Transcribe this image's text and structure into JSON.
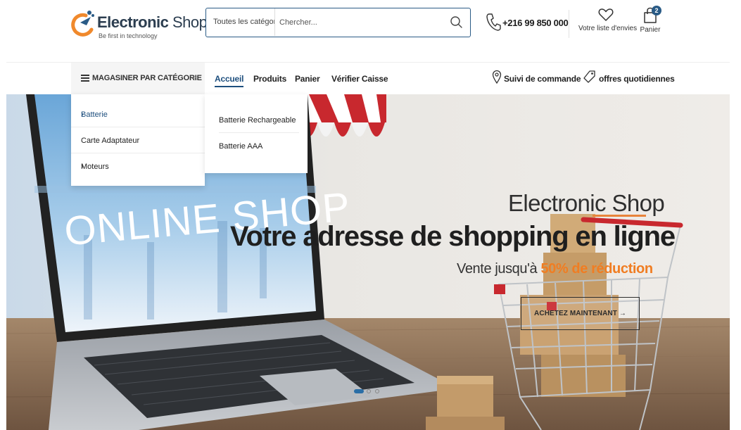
{
  "header": {
    "logo": {
      "brand_bold": "Electronic",
      "brand_light": "Shop",
      "tagline": "Be first in technology"
    },
    "search": {
      "category_label": "Toutes les catégor",
      "placeholder": "Chercher..."
    },
    "phone": "+216 99 850 000",
    "wishlist_label": "Votre liste d'envies",
    "cart": {
      "label": "Panier",
      "count": "2"
    }
  },
  "nav": {
    "category_toggle": "MAGASINER PAR CATÉGORIE",
    "links": [
      "Accueil",
      "Produits",
      "Panier",
      "Vérifier Caisse"
    ],
    "active_link": "Accueil",
    "order_tracking": "Suivi de commande",
    "daily_deals": "offres quotidiennes"
  },
  "category_menu": {
    "items": [
      {
        "label": "Batterie",
        "has_submenu": true,
        "active": true
      },
      {
        "label": "Carte Adaptateur",
        "has_submenu": false,
        "active": false
      },
      {
        "label": "Moteurs",
        "has_submenu": true,
        "active": false
      }
    ],
    "submenu": [
      "Batterie Rechargeable",
      "Batterie AAA"
    ]
  },
  "hero": {
    "brand": "Electronic Shop",
    "title": "Votre adresse de shopping en ligne",
    "subtitle_prefix": "Vente jusqu'à ",
    "subtitle_highlight": "50% de réduction",
    "cta": "ACHETEZ MAINTENANT →",
    "laptop_screen_text": "ONLINE SHOP",
    "slides_total": 3,
    "slide_active": 1
  },
  "colors": {
    "primary": "#1e4f7e",
    "accent": "#f07d22",
    "logo_orange": "#f0892c"
  },
  "icons": [
    "search-icon",
    "phone-icon",
    "heart-icon",
    "bag-icon",
    "menu-icon",
    "chevron-down-icon",
    "location-pin-icon",
    "tag-icon",
    "chevron-right-icon"
  ]
}
